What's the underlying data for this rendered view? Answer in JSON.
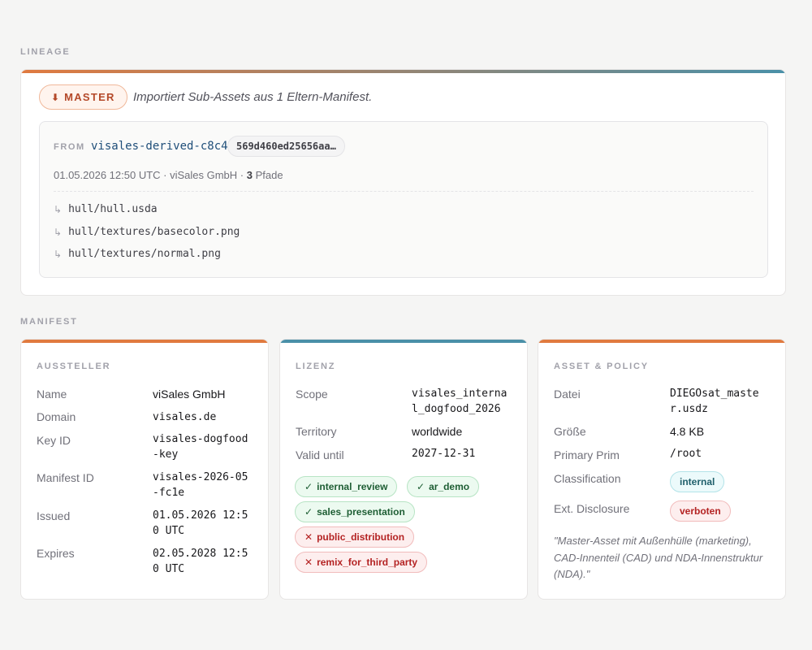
{
  "lineage": {
    "section_label": "LINEAGE",
    "badge": {
      "icon": "arrow-down-icon",
      "arrow": "⬇",
      "label": "MASTER"
    },
    "description": "Importiert Sub-Assets aus 1 Eltern-Manifest.",
    "source": {
      "from_label": "FROM",
      "name": "visales-derived-c8c4",
      "hash": "569d460ed25656aa…",
      "meta_prefix": "01.05.2026 12:50 UTC · viSales GmbH · ",
      "path_count": "3",
      "path_suffix": " Pfade",
      "paths": [
        "hull/hull.usda",
        "hull/textures/basecolor.png",
        "hull/textures/normal.png"
      ]
    }
  },
  "manifest": {
    "section_label": "MANIFEST",
    "issuer": {
      "title": "AUSSTELLER",
      "rows": [
        {
          "label": "Name",
          "value": "viSales GmbH"
        },
        {
          "label": "Domain",
          "value": "visales.de"
        },
        {
          "label": "Key ID",
          "value": "visales-dogfood-key"
        },
        {
          "label": "Manifest ID",
          "value": "visales-2026-05-fc1e"
        },
        {
          "label": "Issued",
          "value": "01.05.2026 12:50 UTC"
        },
        {
          "label": "Expires",
          "value": "02.05.2028 12:50 UTC"
        }
      ]
    },
    "license": {
      "title": "LIZENZ",
      "rows": [
        {
          "label": "Scope",
          "value": "visales_internal_dogfood_2026"
        },
        {
          "label": "Territory",
          "value": "worldwide"
        },
        {
          "label": "Valid until",
          "value": "2027-12-31"
        }
      ],
      "allowed": [
        "internal_review",
        "ar_demo",
        "sales_presentation"
      ],
      "denied": [
        "public_distribution",
        "remix_for_third_party"
      ],
      "allow_mark": "✓",
      "deny_mark": "✕"
    },
    "asset": {
      "title": "ASSET & POLICY",
      "rows": [
        {
          "label": "Datei",
          "value": "DIEGOsat_master.usdz"
        },
        {
          "label": "Größe",
          "value": "4.8 KB"
        },
        {
          "label": "Primary Prim",
          "value": "/root"
        },
        {
          "label": "Classification",
          "value": "internal"
        },
        {
          "label": "Ext. Disclosure",
          "value": "verboten"
        }
      ],
      "note": "\"Master-Asset mit Außenhülle (marketing), CAD-Innenteil (CAD) und NDA-Innenstruktur (NDA).\""
    }
  },
  "colors": {
    "accent_orange": "#e07a3f",
    "accent_teal": "#4a90a8",
    "allow_green": "#1e5e34",
    "deny_red": "#b42323"
  }
}
